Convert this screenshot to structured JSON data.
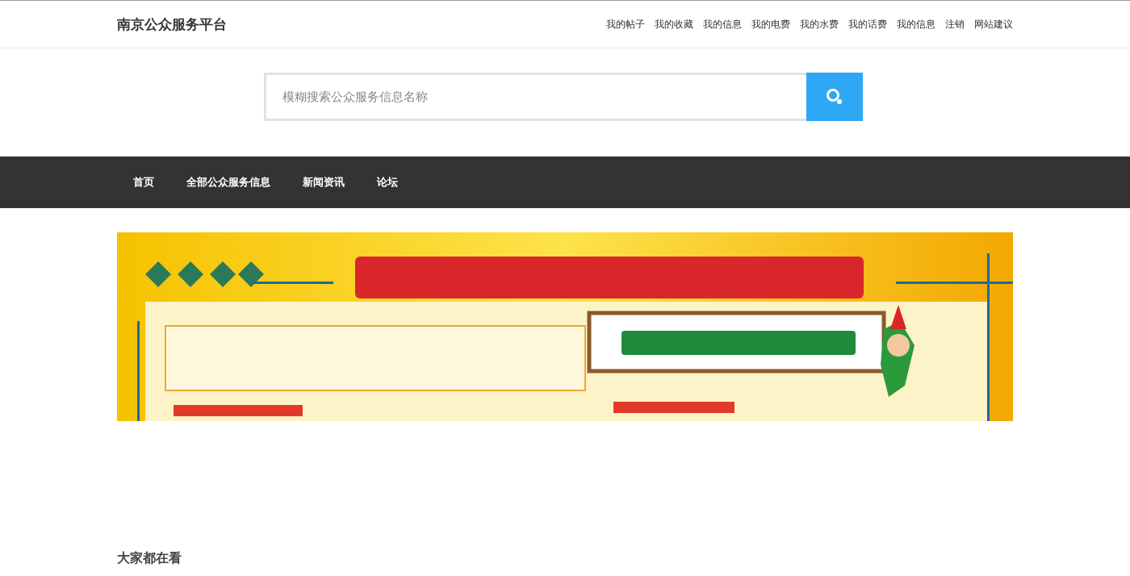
{
  "site_title": "南京公众服务平台",
  "top_links": [
    "我的帖子",
    "我的收藏",
    "我的信息",
    "我的电费",
    "我的水费",
    "我的话费",
    "我的信息",
    "注销",
    "网站建议"
  ],
  "search": {
    "placeholder": "模糊搜索公众服务信息名称"
  },
  "nav": [
    "首页",
    "全部公众服务信息",
    "新闻资讯",
    "论坛"
  ],
  "section_title": "大家都在看"
}
